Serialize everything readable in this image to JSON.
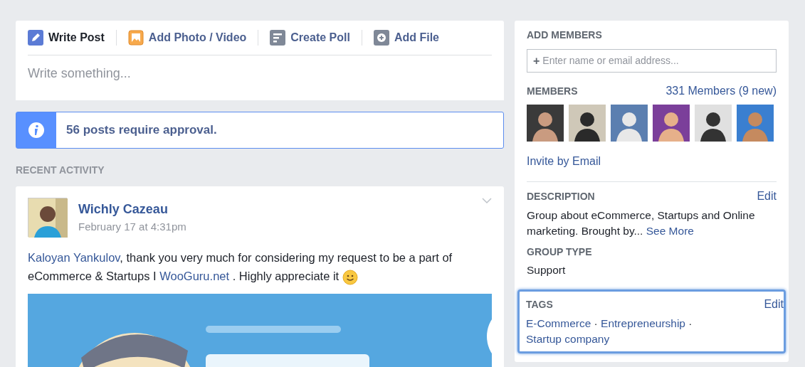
{
  "composer": {
    "tabs": [
      {
        "label": "Write Post",
        "kind": "pencil",
        "selected": true
      },
      {
        "label": "Add Photo / Video",
        "selected": false
      },
      {
        "label": "Create Poll",
        "kind": "poll",
        "selected": false
      },
      {
        "label": "Add File",
        "kind": "file",
        "selected": false
      }
    ],
    "placeholder": "Write something..."
  },
  "approval_notice": "56 posts require approval.",
  "recent_activity": {
    "heading": "RECENT ACTIVITY",
    "post": {
      "author": "Wichly Cazeau",
      "time": "February 17 at 4:31pm",
      "segments": [
        {
          "text": "Kaloyan Yankulov",
          "kind": "link"
        },
        {
          "text": ", thank you very much for considering my request to be a part of eCommerce & Startups I ",
          "kind": "text"
        },
        {
          "text": "WooGuru.net",
          "kind": "link"
        },
        {
          "text": " . Highly appreciate it ",
          "kind": "text"
        },
        {
          "kind": "smiley"
        }
      ]
    }
  },
  "sidebar": {
    "add_members": {
      "heading": "ADD MEMBERS",
      "icon": "+",
      "placeholder": "Enter name or email address..."
    },
    "members": {
      "heading": "MEMBERS",
      "count": "331 Members (9 new)",
      "invite": "Invite by Email"
    },
    "description": {
      "heading": "DESCRIPTION",
      "edit": "Edit",
      "text": "Group about eCommerce, Startups and Online marketing. Brought by...",
      "more": "See More"
    },
    "group_type": {
      "heading": "GROUP TYPE",
      "value": "Support"
    },
    "tags": {
      "heading": "TAGS",
      "edit": "Edit",
      "focused": true,
      "separator": "·",
      "items": [
        "E-Commerce",
        "Entrepreneurship",
        "Startup company"
      ]
    }
  }
}
